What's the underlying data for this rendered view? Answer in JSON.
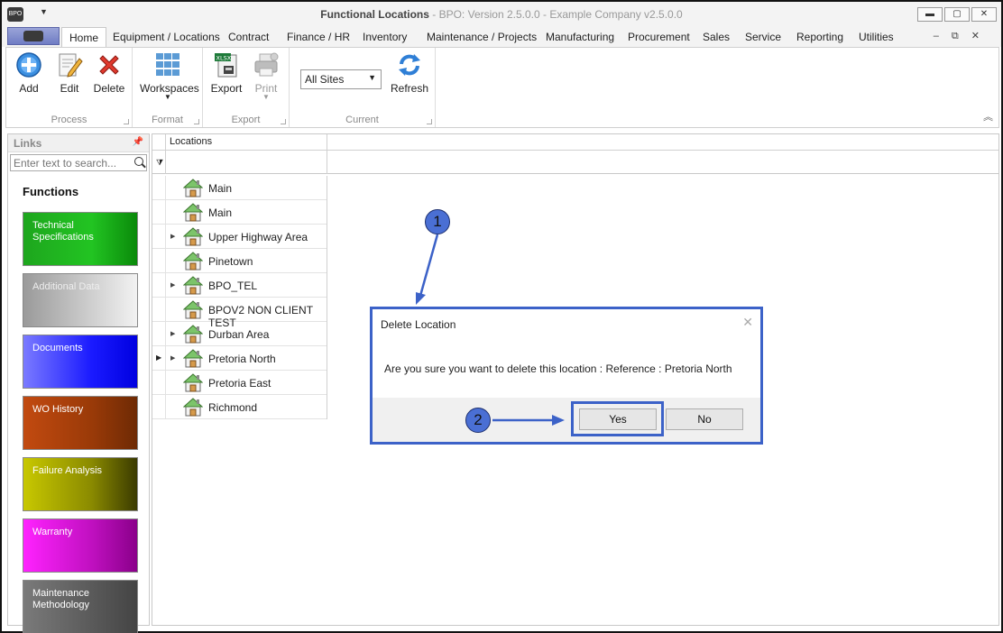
{
  "window": {
    "title_main": "Functional Locations",
    "title_rest": " - BPO: Version 2.5.0.0 - Example Company v2.5.0.0"
  },
  "menu": {
    "tabs": [
      "Home",
      "Equipment / Locations",
      "Contract",
      "Finance / HR",
      "Inventory",
      "Maintenance / Projects",
      "Manufacturing",
      "Procurement",
      "Sales",
      "Service",
      "Reporting",
      "Utilities"
    ]
  },
  "ribbon": {
    "process": {
      "label": "Process",
      "add": "Add",
      "edit": "Edit",
      "delete": "Delete"
    },
    "format": {
      "label": "Format",
      "workspaces": "Workspaces"
    },
    "export": {
      "label": "Export",
      "export": "Export",
      "print": "Print"
    },
    "current": {
      "label": "Current",
      "site": "All Sites",
      "refresh": "Refresh"
    }
  },
  "links": {
    "header": "Links",
    "search_placeholder": "Enter text to search...",
    "functions_title": "Functions",
    "tiles": [
      {
        "label": "Technical Specifications"
      },
      {
        "label": "Additional Data"
      },
      {
        "label": "Documents"
      },
      {
        "label": "WO History"
      },
      {
        "label": "Failure Analysis"
      },
      {
        "label": "Warranty"
      },
      {
        "label": "Maintenance Methodology"
      }
    ]
  },
  "grid": {
    "column": "Locations",
    "rows": [
      {
        "name": "Main",
        "expandable": false,
        "selected": false
      },
      {
        "name": "Main",
        "expandable": false,
        "selected": false
      },
      {
        "name": "Upper Highway Area",
        "expandable": true,
        "selected": false
      },
      {
        "name": "Pinetown",
        "expandable": false,
        "selected": false
      },
      {
        "name": "BPO_TEL",
        "expandable": true,
        "selected": false
      },
      {
        "name": "BPOV2 NON CLIENT TEST",
        "expandable": false,
        "selected": false
      },
      {
        "name": "Durban Area",
        "expandable": true,
        "selected": false
      },
      {
        "name": "Pretoria North",
        "expandable": true,
        "selected": true
      },
      {
        "name": "Pretoria East",
        "expandable": false,
        "selected": false
      },
      {
        "name": "Richmond",
        "expandable": false,
        "selected": false
      }
    ]
  },
  "dialog": {
    "title": "Delete Location",
    "message": "Are you sure you want to delete this location : Reference : Pretoria North",
    "yes": "Yes",
    "no": "No"
  },
  "callouts": {
    "one": "1",
    "two": "2"
  },
  "colors": {
    "highlight": "#3c62c8",
    "callout": "#4a6fd4"
  }
}
